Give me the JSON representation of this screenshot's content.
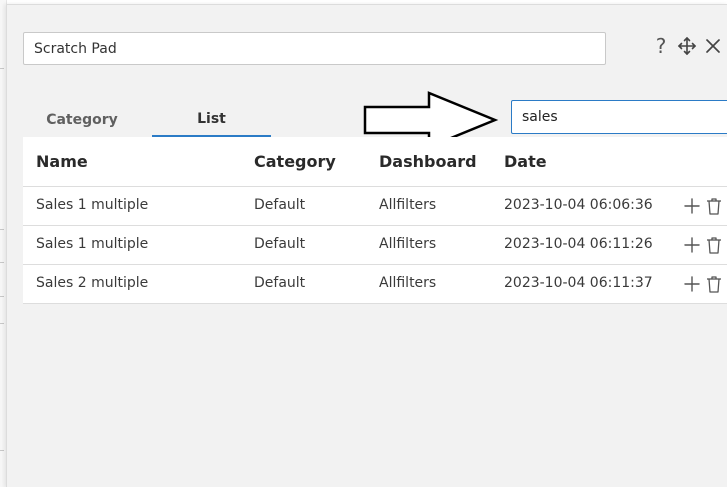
{
  "panel": {
    "title_value": "Scratch Pad"
  },
  "header": {
    "help_label": "?"
  },
  "tabs": [
    {
      "label": "Category"
    },
    {
      "label": "List"
    }
  ],
  "active_tab": "List",
  "search": {
    "value": "sales"
  },
  "table": {
    "headers": [
      "Name",
      "Category",
      "Dashboard",
      "Date"
    ],
    "rows": [
      [
        "Sales 1 multiple",
        "Default",
        "Allfilters",
        "2023-10-04 06:06:36"
      ],
      [
        "Sales 1 multiple",
        "Default",
        "Allfilters",
        "2023-10-04 06:11:26"
      ],
      [
        "Sales 2 multiple",
        "Default",
        "Allfilters",
        "2023-10-04 06:11:37"
      ]
    ]
  },
  "icons": {
    "help": "help-icon",
    "move": "move-icon",
    "close": "close-icon",
    "add": "plus-icon",
    "delete": "trash-icon",
    "annotation": "arrow-annotation"
  },
  "colors": {
    "accent": "#2b7bc6",
    "panel_bg": "#f2f2f2",
    "text": "#333333"
  }
}
